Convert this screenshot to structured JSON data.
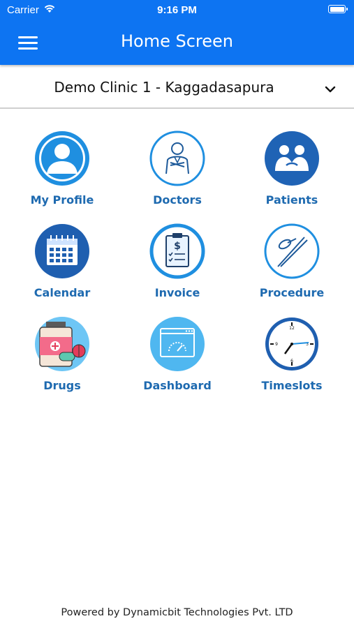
{
  "status_bar": {
    "carrier": "Carrier",
    "time": "9:16 PM"
  },
  "header": {
    "title": "Home Screen",
    "menu_icon": "hamburger-menu-icon",
    "background": "#0d74f2"
  },
  "clinic_selector": {
    "selected": "Demo Clinic 1 - Kaggadasapura",
    "icon": "chevron-down-icon"
  },
  "tiles": [
    {
      "label": "My Profile",
      "icon": "profile-icon"
    },
    {
      "label": "Doctors",
      "icon": "doctor-icon"
    },
    {
      "label": "Patients",
      "icon": "patients-icon"
    },
    {
      "label": "Calendar",
      "icon": "calendar-icon"
    },
    {
      "label": "Invoice",
      "icon": "invoice-icon"
    },
    {
      "label": "Procedure",
      "icon": "procedure-icon"
    },
    {
      "label": "Drugs",
      "icon": "drugs-icon"
    },
    {
      "label": "Dashboard",
      "icon": "dashboard-icon"
    },
    {
      "label": "Timeslots",
      "icon": "clock-icon"
    }
  ],
  "footer": {
    "text": "Powered by Dynamicbit Technologies Pvt. LTD"
  },
  "colors": {
    "tile_label": "#1e6ab0",
    "accent": "#0d74f2"
  }
}
